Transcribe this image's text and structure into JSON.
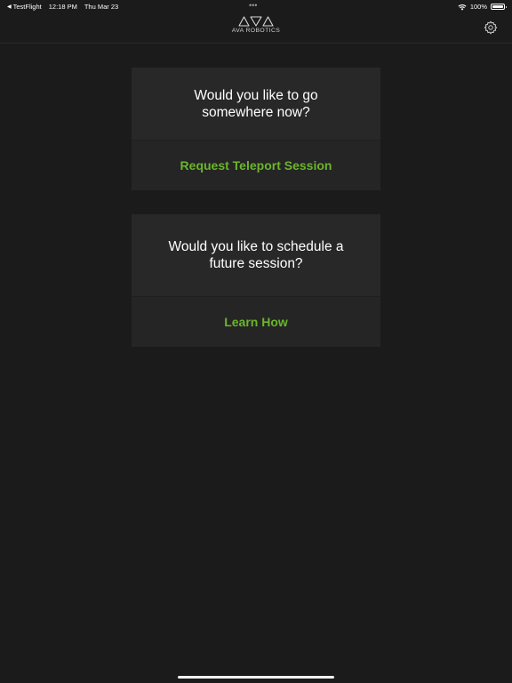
{
  "status_bar": {
    "back_app": "TestFlight",
    "time": "12:18 PM",
    "date": "Thu Mar 23",
    "multitask_dots": "•••",
    "battery_percent": "100%",
    "battery_level": 1.0,
    "wifi_icon": "wifi-icon",
    "battery_icon": "battery-icon"
  },
  "nav": {
    "logo_text": "AVA ROBOTICS",
    "logo_icon": "ava-logo-mark",
    "settings_icon": "gear-icon"
  },
  "cards": [
    {
      "question": "Would you like to go somewhere now?",
      "action_label": "Request Teleport Session"
    },
    {
      "question": "Would you like to schedule a future session?",
      "action_label": "Learn How"
    }
  ],
  "colors": {
    "background": "#1b1b1b",
    "card": "#282828",
    "accent_green": "#6bb52c",
    "text": "#ffffff"
  }
}
